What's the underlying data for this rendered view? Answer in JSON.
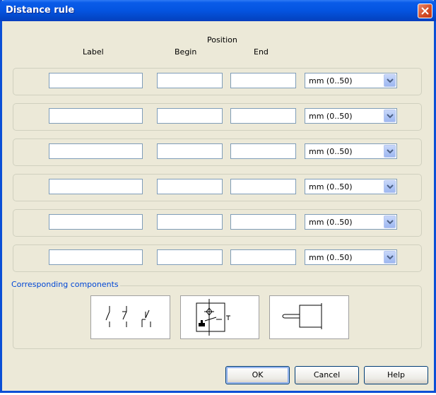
{
  "window": {
    "title": "Distance rule"
  },
  "headers": {
    "position": "Position",
    "label": "Label",
    "begin": "Begin",
    "end": "End"
  },
  "rows": [
    {
      "label": "",
      "begin": "",
      "end": "",
      "unit": "mm  (0..50)"
    },
    {
      "label": "",
      "begin": "",
      "end": "",
      "unit": "mm  (0..50)"
    },
    {
      "label": "",
      "begin": "",
      "end": "",
      "unit": "mm  (0..50)"
    },
    {
      "label": "",
      "begin": "",
      "end": "",
      "unit": "mm  (0..50)"
    },
    {
      "label": "",
      "begin": "",
      "end": "",
      "unit": "mm  (0..50)"
    },
    {
      "label": "",
      "begin": "",
      "end": "",
      "unit": "mm  (0..50)"
    }
  ],
  "components": {
    "group_label": "Corresponding components",
    "icons": [
      "switch-contacts-icon",
      "proximity-sensor-icon",
      "plug-connector-icon"
    ]
  },
  "buttons": {
    "ok": "OK",
    "cancel": "Cancel",
    "help": "Help"
  },
  "colors": {
    "title_bar": "#0454e0",
    "close_button": "#d24a22",
    "group_label": "#0046d5",
    "face": "#ece9d8"
  }
}
